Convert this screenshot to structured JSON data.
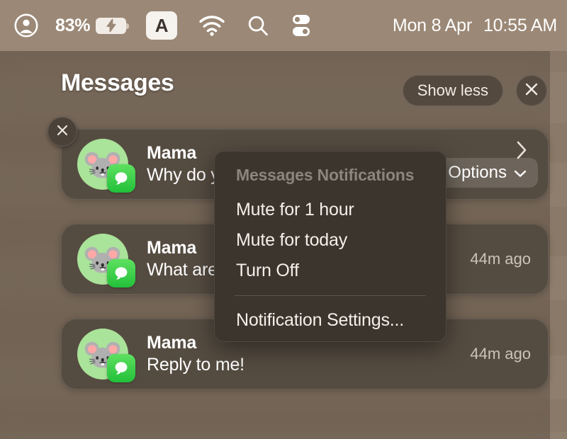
{
  "menubar": {
    "account_icon": "account-circle-icon",
    "battery_percent": "83%",
    "battery_icon": "battery-charging-icon",
    "input_source": "A",
    "wifi_icon": "wifi-icon",
    "search_icon": "search-icon",
    "control_center_icon": "control-center-icon",
    "date": "Mon 8 Apr",
    "time": "10:55 AM"
  },
  "notification_center": {
    "group_title": "Messages",
    "show_less_label": "Show less",
    "close_icon": "close-icon",
    "card_close_icon": "close-icon",
    "chevron_icon": "chevron-right-icon",
    "options_label": "Options",
    "options_chevron_icon": "chevron-down-icon",
    "app_badge_icon": "messages-app-icon",
    "avatar_icon": "mouse-emoji-avatar",
    "notifications": [
      {
        "sender": "Mama",
        "body": "Why do y",
        "time": "",
        "avatar": "🐭"
      },
      {
        "sender": "Mama",
        "body": "What are",
        "time": "44m ago",
        "avatar": "🐭"
      },
      {
        "sender": "Mama",
        "body": "Reply to me!",
        "time": "44m ago",
        "avatar": "🐭"
      }
    ]
  },
  "context_menu": {
    "header": "Messages Notifications",
    "items": [
      {
        "label": "Mute for 1 hour"
      },
      {
        "label": "Mute for today"
      },
      {
        "label": "Turn Off"
      }
    ],
    "settings_item": "Notification Settings..."
  },
  "colors": {
    "menubar_bg": "#9b8876",
    "desktop_bg": "#8a7968",
    "card_bg": "#554c41",
    "menu_bg": "#3c352d",
    "avatar_green": "#aae39a",
    "badge_green": "#22c03a",
    "text_primary": "#ffffff",
    "text_secondary": "#cdc3b8",
    "menu_header_gray": "#8d857c"
  }
}
